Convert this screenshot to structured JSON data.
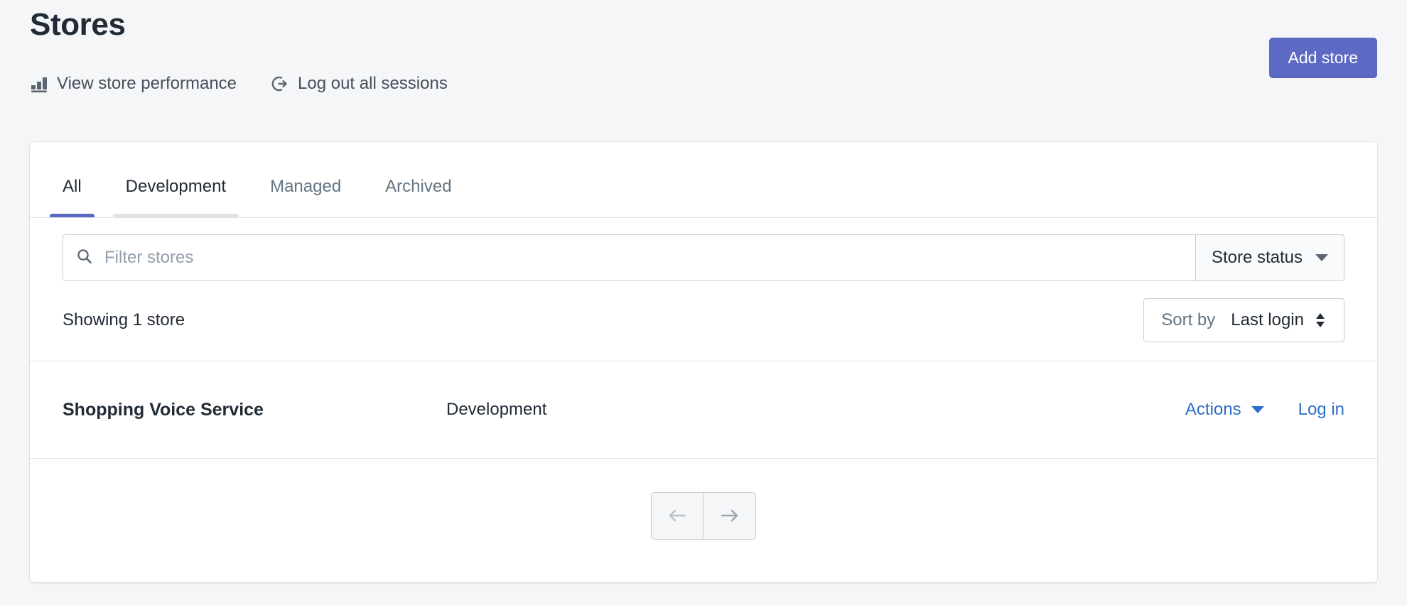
{
  "header": {
    "title": "Stores",
    "actions": [
      {
        "icon": "bar-chart-icon",
        "label": "View store performance"
      },
      {
        "icon": "logout-icon",
        "label": "Log out all sessions"
      }
    ],
    "add_store_label": "Add store"
  },
  "tabs": [
    {
      "label": "All",
      "state": "active"
    },
    {
      "label": "Development",
      "state": "hovered"
    },
    {
      "label": "Managed",
      "state": "default"
    },
    {
      "label": "Archived",
      "state": "default"
    }
  ],
  "filters": {
    "search": {
      "placeholder": "Filter stores",
      "value": "",
      "icon": "search-icon"
    },
    "status_button": {
      "label": "Store status",
      "icon": "chevron-down-icon"
    }
  },
  "results": {
    "showing_text": "Showing 1 store",
    "sort": {
      "label": "Sort by",
      "value": "Last login",
      "icon": "sort-updown-icon"
    }
  },
  "store_list": {
    "rows": [
      {
        "name": "Shopping Voice Service",
        "plan": "Development",
        "actions_label": "Actions",
        "login_label": "Log in"
      }
    ]
  },
  "pagination": {
    "prev_icon": "arrow-left-icon",
    "next_icon": "arrow-right-icon"
  },
  "colors": {
    "page_background": "#f4f6f8",
    "accent": "#5c6ac4",
    "link": "#2c6ecb",
    "text_primary": "#212b36",
    "text_subdued": "#637381",
    "border": "#c4cdd5",
    "divider": "#e1e3e5"
  }
}
